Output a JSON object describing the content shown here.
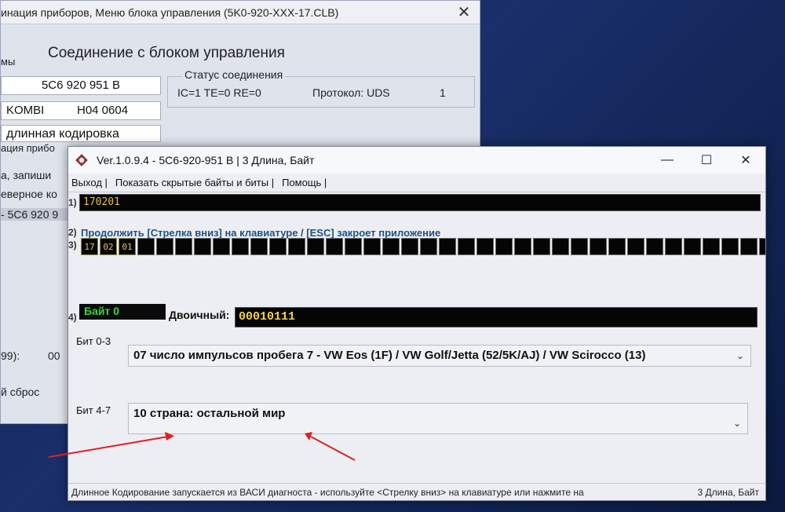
{
  "back_window": {
    "title": "инация приборов,  Меню блока управления (5K0-920-XXX-17.CLB)",
    "heading": "Соединение с блоком управления",
    "left_label": "мы",
    "part_number": "5C6 920 951 B",
    "kombi": "KOMBI",
    "sw_version": "H04 0604",
    "coding_type": "длинная кодировка",
    "line_ation": "ация прибо",
    "line_zapish": "а, запиши",
    "line_vern": "еверное ко",
    "line_pn": "- 5C6 920 9",
    "line_999": "99):",
    "line_00": "00",
    "line_reset": "й сброс",
    "status": {
      "legend": "Статус соединения",
      "ic": "IC=1  TE=0  RE=0",
      "protocol": "Протокол: UDS",
      "indicator": "1"
    }
  },
  "front_window": {
    "title": "Ver.1.0.9.4 -    5C6-920-951 B | 3 Длина, Байт",
    "menu": {
      "exit": "Выход |",
      "show_hidden": "Показать скрытые байты и биты |",
      "help": "Помощь |"
    },
    "row1": {
      "num": "1)",
      "value": "170201"
    },
    "row2": {
      "num": "2)",
      "text": "Продолжить [Стрелка вниз] на клавиатуре / [ESC] закроет приложение"
    },
    "row3": {
      "num": "3)",
      "bytes": [
        "17",
        "02",
        "01",
        "",
        "",
        "",
        "",
        "",
        "",
        "",
        "",
        "",
        "",
        "",
        "",
        "",
        "",
        "",
        "",
        "",
        "",
        "",
        "",
        "",
        "",
        "",
        "",
        "",
        "",
        "",
        "",
        "",
        "",
        "",
        "",
        "",
        ""
      ]
    },
    "row4": {
      "num": "4)",
      "byte_label": "Байт 0",
      "binary_label": "Двоичный:",
      "binary_value": "00010111"
    },
    "bits_0_3": {
      "label": "Бит 0-3",
      "value": "07 число импульсов пробега 7 - VW Eos (1F) / VW Golf/Jetta (52/5K/AJ) / VW Scirocco (13)"
    },
    "bits_4_7": {
      "label": "Бит 4-7",
      "value": "10 страна: остальной мир"
    },
    "statusbar": {
      "left": "Длинное Кодирование  запускается из ВАСИ диагноста - используйте <Стрелку вниз> на клавиатуре или нажмите на",
      "right": "3 Длина, Байт"
    }
  },
  "colors": {
    "annotation_arrow": "#e02020",
    "byte_text": "#e8c242",
    "byte_label": "#3fd33f",
    "info_text": "#1f4f86"
  }
}
